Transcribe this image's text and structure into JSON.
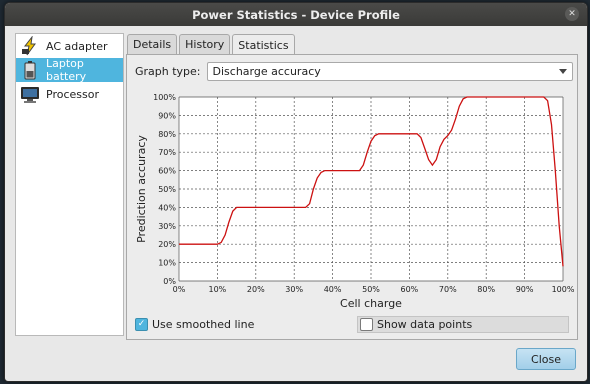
{
  "window": {
    "title": "Power Statistics - Device Profile"
  },
  "sidebar": {
    "items": [
      {
        "label": "AC adapter",
        "icon": "ac-adapter-icon",
        "selected": false
      },
      {
        "label": "Laptop battery",
        "icon": "battery-icon",
        "selected": true
      },
      {
        "label": "Processor",
        "icon": "processor-icon",
        "selected": false
      }
    ]
  },
  "tabs": [
    {
      "label": "Details"
    },
    {
      "label": "History"
    },
    {
      "label": "Statistics",
      "active": true
    }
  ],
  "graph_type": {
    "label": "Graph type:",
    "value": "Discharge accuracy"
  },
  "options": {
    "smoothed": {
      "label": "Use smoothed line",
      "checked": true
    },
    "data_points": {
      "label": "Show data points",
      "checked": false
    }
  },
  "buttons": {
    "close": "Close"
  },
  "colors": {
    "accent": "#4fb5de",
    "line": "#cc1111"
  },
  "chart_data": {
    "type": "line",
    "xlabel": "Cell charge",
    "ylabel": "Prediction accuracy",
    "xlim": [
      0,
      100
    ],
    "ylim": [
      0,
      100
    ],
    "x_ticks": [
      "0%",
      "10%",
      "20%",
      "30%",
      "40%",
      "50%",
      "60%",
      "70%",
      "80%",
      "90%",
      "100%"
    ],
    "y_ticks": [
      "0%",
      "10%",
      "20%",
      "30%",
      "40%",
      "50%",
      "60%",
      "70%",
      "80%",
      "90%",
      "100%"
    ],
    "grid": true,
    "series": [
      {
        "points": [
          [
            0,
            20
          ],
          [
            10,
            20
          ],
          [
            11,
            21
          ],
          [
            12,
            25
          ],
          [
            13,
            32
          ],
          [
            14,
            38
          ],
          [
            15,
            40
          ],
          [
            20,
            40
          ],
          [
            30,
            40
          ],
          [
            33,
            40
          ],
          [
            34,
            42
          ],
          [
            35,
            50
          ],
          [
            36,
            56
          ],
          [
            37,
            59
          ],
          [
            38,
            60
          ],
          [
            45,
            60
          ],
          [
            47,
            60
          ],
          [
            48,
            63
          ],
          [
            49,
            70
          ],
          [
            50,
            76
          ],
          [
            51,
            79
          ],
          [
            52,
            80
          ],
          [
            60,
            80
          ],
          [
            62,
            80
          ],
          [
            63,
            78
          ],
          [
            64,
            72
          ],
          [
            65,
            66
          ],
          [
            66,
            63
          ],
          [
            67,
            66
          ],
          [
            68,
            73
          ],
          [
            69,
            77
          ],
          [
            70,
            79
          ],
          [
            71,
            82
          ],
          [
            72,
            88
          ],
          [
            73,
            95
          ],
          [
            74,
            99
          ],
          [
            75,
            100
          ],
          [
            80,
            100
          ],
          [
            90,
            100
          ],
          [
            95,
            100
          ],
          [
            96,
            98
          ],
          [
            97,
            85
          ],
          [
            98,
            60
          ],
          [
            99,
            30
          ],
          [
            100,
            8
          ]
        ]
      }
    ]
  }
}
